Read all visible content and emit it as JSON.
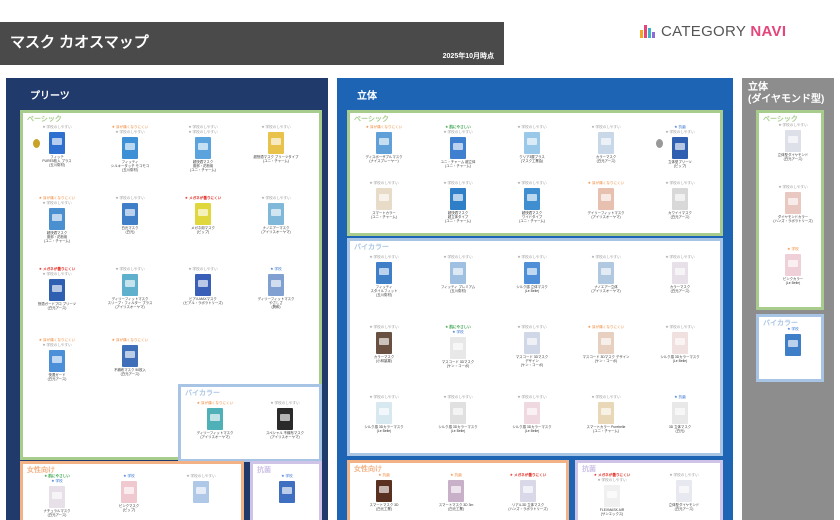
{
  "header": {
    "title": "マスク カオスマップ",
    "date": "2025年10月時点"
  },
  "logo": {
    "text_a": "CATEGORY ",
    "text_b": "NAVI",
    "bar_colors": [
      "#f6a623",
      "#e4457a",
      "#3db1c8",
      "#8c6bd6"
    ]
  },
  "columns": {
    "pleats": {
      "title": "プリーツ",
      "color": "#1f3a6b"
    },
    "rittai": {
      "title": "立体",
      "color": "#1e64b4"
    },
    "diamond": {
      "title": "立体\n(ダイヤモンド型)",
      "color": "#8d8d8d"
    }
  },
  "sections": {
    "p_basic": {
      "title": "ベーシック",
      "color": "#a8cc8c"
    },
    "p_bicolor": {
      "title": "バイカラー",
      "color": "#a8c4e4"
    },
    "p_women": {
      "title": "女性向け",
      "color": "#f2b286"
    },
    "p_fashion": {
      "title": "抗菌",
      "color": "#cfc4e8"
    },
    "r_basic": {
      "title": "ベーシック",
      "color": "#a8cc8c"
    },
    "r_bicolor": {
      "title": "バイカラー",
      "color": "#a8c4e4"
    },
    "r_women": {
      "title": "女性向け",
      "color": "#f2b286"
    },
    "r_fashion": {
      "title": "抗菌",
      "color": "#cfc4e8"
    },
    "d_basic": {
      "title": "ベーシック",
      "color": "#a8cc8c"
    },
    "d_bicolor": {
      "title": "バイカラー",
      "color": "#a8c4e4"
    }
  },
  "items": [
    {
      "t1": "★ 学校のしやすい",
      "c1": "gray",
      "t2": "",
      "c2": "blank",
      "name": "フィッテ\nPURE5枚入 プラス\n(玉川衛材)",
      "color": "#2f6fd0",
      "medal": "#c9a227"
    },
    {
      "t1": "★ 耳が痛くなりにくい",
      "c1": "orange",
      "t2": "★ 学校のしやすい",
      "c2": "gray",
      "name": "フィッティ\nシルキータッチ モコモコ\n(玉川衛材)",
      "color": "#3d8fd6",
      "medal": ""
    },
    {
      "t1": "★ 学校のしやすい",
      "c1": "gray",
      "t2": "★ 学校のしやすい",
      "c2": "gray",
      "name": "超快適マスク\n風邪・花粉用\n(ユニ・チャーム)",
      "color": "#5aa3dc",
      "medal": ""
    },
    {
      "t1": "★ 学校のしやすい",
      "c1": "gray",
      "t2": "",
      "c2": "blank",
      "name": "超快適マスク プリーツタイプ\n(ユニ・チャーム)",
      "color": "#e8c24a",
      "medal": ""
    },
    {
      "t1": "★ 耳が痛くなりにくい",
      "c1": "orange",
      "t2": "★ 学校のしやすい",
      "c2": "gray",
      "name": "超快適マスク\n風邪・花粉用\n(ユニ・チャーム)",
      "color": "#4a8fd0",
      "medal": ""
    },
    {
      "t1": "★ 学校のしやすい",
      "c1": "gray",
      "t2": "",
      "c2": "blank",
      "name": "白元マスク\n(白元)",
      "color": "#3f7fc8",
      "medal": ""
    },
    {
      "t1": "★ メガネが曇りにくい",
      "c1": "red",
      "t2": "",
      "c2": "blank",
      "name": "メガネ用マスク\n(ピップ)",
      "color": "#e0d73c",
      "medal": ""
    },
    {
      "t1": "★ 学校のしやすい",
      "c1": "gray",
      "t2": "",
      "c2": "blank",
      "name": "ナノエアーマスク\n(アイリスオーヤマ)",
      "color": "#7fb8d8",
      "medal": ""
    },
    {
      "t1": "★ メガネが曇りにくい",
      "c1": "red",
      "t2": "★ 学校のしやすい",
      "c2": "gray",
      "name": "快適ガードプロ プリーツ\n(白元アース)",
      "color": "#2f5fb0",
      "medal": ""
    },
    {
      "t1": "★ 学校のしやすい",
      "c1": "gray",
      "t2": "",
      "c2": "blank",
      "name": "ディリーフィットマスク\nスリープ・フィルター プラス\n(アイリスオーヤマ)",
      "color": "#5fb0cc",
      "medal": ""
    },
    {
      "t1": "★ 学校のしやすい",
      "c1": "gray",
      "t2": "",
      "c2": "blank",
      "name": "ビアルMAXマスク\n(ビアル・ラボラトリーズ)",
      "color": "#3a5fb8",
      "medal": ""
    },
    {
      "t1": "★ 学校",
      "c1": "blue",
      "t2": "",
      "c2": "blank",
      "name": "ディリーフィットマスク\nやさしさ\n(興和)",
      "color": "#7fa0d0",
      "medal": ""
    },
    {
      "t1": "★ 耳が痛くなりにくい",
      "c1": "orange",
      "t2": "★ 学校のしやすい",
      "c2": "gray",
      "name": "快適ガード\n(白元アース)",
      "color": "#4a8fd8",
      "medal": ""
    },
    {
      "t1": "★ 耳が痛くなりにくい",
      "c1": "orange",
      "t2": "",
      "c2": "blank",
      "name": "不織布マスク 50枚入\n(白元アース)",
      "color": "#3f6fb8",
      "medal": ""
    },
    {
      "t1": "★ 耳が痛くなりにくい",
      "c1": "orange",
      "t2": "",
      "c2": "blank",
      "name": "ディリーフィットマスク\n(アイリスオーヤマ)",
      "color": "#4fb0b8",
      "medal": ""
    },
    {
      "t1": "★ 学校のしやすい",
      "c1": "gray",
      "t2": "",
      "c2": "blank",
      "name": "スペシャル 不織布マスク\n(アイリスオーヤマ)",
      "color": "#2a2a2a",
      "medal": ""
    },
    {
      "t1": "★ 耳が痛くなりにくい",
      "c1": "orange",
      "t2": "",
      "c2": "blank",
      "name": "ディスポーザブルマスク\n(ナイスプレーヤー)",
      "color": "#5fa0d8",
      "medal": ""
    },
    {
      "t1": "★ 肌にやさしい",
      "c1": "green",
      "t2": "★ 学校のしやすい",
      "c2": "gray",
      "name": "ユニ・チャーム 超立体\n(ユニ・チャーム)",
      "color": "#3f7fd0",
      "medal": ""
    },
    {
      "t1": "★ 学校のしやすい",
      "c1": "gray",
      "t2": "",
      "c2": "blank",
      "name": "クリア3層プラス\n(マスク工業会)",
      "color": "#9ac8e8",
      "medal": ""
    },
    {
      "t1": "★ 学校のしやすい",
      "c1": "gray",
      "t2": "",
      "c2": "blank",
      "name": "カラーマスク\n(白元アース)",
      "color": "#c8d8e8",
      "medal": ""
    },
    {
      "t1": "★ 抗菌",
      "c1": "blue",
      "t2": "★ 学校のしやすい",
      "c2": "gray",
      "name": "立体型プリーツ\n(ピップ)",
      "color": "#2f5fb0",
      "medal": "#999"
    },
    {
      "t1": "★ 学校のしやすい",
      "c1": "gray",
      "t2": "",
      "c2": "blank",
      "name": "スマートカラー\n(ユニ・チャーム)",
      "color": "#e8dcc8",
      "medal": ""
    },
    {
      "t1": "★ 学校のしやすい",
      "c1": "gray",
      "t2": "",
      "c2": "blank",
      "name": "超快適マスク\n超立体タイプ\n(ユニ・チャーム)",
      "color": "#2f7fc8",
      "medal": ""
    },
    {
      "t1": "★ 学校のしやすい",
      "c1": "gray",
      "t2": "",
      "c2": "blank",
      "name": "超快適マスク\nワイドタイプ\n(ユニ・チャーム)",
      "color": "#3f8fd0",
      "medal": ""
    },
    {
      "t1": "★ 耳が痛くなりにくい",
      "c1": "orange",
      "t2": "",
      "c2": "blank",
      "name": "デイリーフィットマスク\n(アイリスオーヤマ)",
      "color": "#e8c0b0",
      "medal": ""
    },
    {
      "t1": "★ 学校のしやすい",
      "c1": "gray",
      "t2": "",
      "c2": "blank",
      "name": "カワイイマスク\n(白元アース)",
      "color": "#d8d8d8",
      "medal": ""
    },
    {
      "t1": "★ 学校のしやすい",
      "c1": "gray",
      "t2": "",
      "c2": "blank",
      "name": "フィッティ\nスタイルフィット\n(玉川衛材)",
      "color": "#3f7fc8",
      "medal": ""
    },
    {
      "t1": "★ 学校のしやすい",
      "c1": "gray",
      "t2": "",
      "c2": "blank",
      "name": "フィッティ プレミアム\n(玉川衛材)",
      "color": "#9fc0e0",
      "medal": ""
    },
    {
      "t1": "★ 学校のしやすい",
      "c1": "gray",
      "t2": "",
      "c2": "blank",
      "name": "シルク感 立体マスク\n(Le Belle)",
      "color": "#4f8fd8",
      "medal": ""
    },
    {
      "t1": "★ 学校のしやすい",
      "c1": "gray",
      "t2": "",
      "c2": "blank",
      "name": "ナノエアー立体\n(アイリスオーヤマ)",
      "color": "#b0c8e0",
      "medal": ""
    },
    {
      "t1": "★ 学校のしやすい",
      "c1": "gray",
      "t2": "",
      "c2": "blank",
      "name": "カラーマスク\n(白元アース)",
      "color": "#e8e0e8",
      "medal": ""
    },
    {
      "t1": "★ 学校のしやすい",
      "c1": "gray",
      "t2": "",
      "c2": "blank",
      "name": "カラーマスク\n(小林製薬)",
      "color": "#6a5040",
      "medal": ""
    },
    {
      "t1": "★ 肌にやさしい",
      "c1": "green",
      "t2": "★ 学校",
      "c2": "blue",
      "name": "マスコード 3Dマスク\n(ケン・コーポ)",
      "color": "#e8e8e8",
      "medal": ""
    },
    {
      "t1": "★ 学校のしやすい",
      "c1": "gray",
      "t2": "",
      "c2": "blank",
      "name": "マスコード 3Dマスク\nデザイン\n(ケン・コーポ)",
      "color": "#d0d8e8",
      "medal": ""
    },
    {
      "t1": "★ 耳が痛くなりにくい",
      "c1": "orange",
      "t2": "",
      "c2": "blank",
      "name": "マスコード 3Dマスク デザイン\n(ケン・コーポ)",
      "color": "#e8d0c0",
      "medal": ""
    },
    {
      "t1": "★ 学校のしやすい",
      "c1": "gray",
      "t2": "",
      "c2": "blank",
      "name": "シルク感 3Dカラーマスク\n(Le Belle)",
      "color": "#f0e0e0",
      "medal": ""
    },
    {
      "t1": "★ 学校のしやすい",
      "c1": "gray",
      "t2": "",
      "c2": "blank",
      "name": "シルク感 3Dカラーマスク\n(Le Belle)",
      "color": "#d8e8f0",
      "medal": ""
    },
    {
      "t1": "★ 学校のしやすい",
      "c1": "gray",
      "t2": "",
      "c2": "blank",
      "name": "シルク感 3Dカラーマスク\n(Le Belle)",
      "color": "#e0e0e0",
      "medal": ""
    },
    {
      "t1": "★ 学校のしやすい",
      "c1": "gray",
      "t2": "",
      "c2": "blank",
      "name": "シルク感 3Dカラーマスク\n(Le Belle)",
      "color": "#f0d8e0",
      "medal": ""
    },
    {
      "t1": "★ 学校のしやすい",
      "c1": "gray",
      "t2": "",
      "c2": "blank",
      "name": "スマートカラー Purebelle\n(ユニ・チャーム)",
      "color": "#e8d8b8",
      "medal": ""
    },
    {
      "t1": "★ 抗菌",
      "c1": "blue",
      "t2": "",
      "c2": "blank",
      "name": "3D 立体マスク\n(白元)",
      "color": "#e8e8e8",
      "medal": ""
    },
    {
      "t1": "★ 抗菌",
      "c1": "orange",
      "t2": "",
      "c2": "blank",
      "name": "スマートマスク 3D\n(白元工業)",
      "color": "#5a3020",
      "medal": ""
    },
    {
      "t1": "★ 抗菌",
      "c1": "orange",
      "t2": "",
      "c2": "blank",
      "name": "スマートマスク 3D 3m\n(白元工業)",
      "color": "#c8b0c8",
      "medal": ""
    },
    {
      "t1": "★ メガネが曇りにくい",
      "c1": "red",
      "t2": "",
      "c2": "blank",
      "name": "リアル3D 立体マスク\n(ハンズ・ラボラトリーズ)",
      "color": "#d8d8e8",
      "medal": ""
    },
    {
      "t1": "★ メガネが曇りにくい",
      "c1": "red",
      "t2": "★ 学校のしやすい",
      "c2": "gray",
      "name": "FLEXMASK AIR\n(サンエックス)",
      "color": "#f0f0f0",
      "medal": ""
    },
    {
      "t1": "★ 学校のしやすい",
      "c1": "gray",
      "t2": "",
      "c2": "blank",
      "name": "立体型ダイヤモンド\n(白元アース)",
      "color": "#e8e8f0",
      "medal": ""
    },
    {
      "t1": "★ 学校のしやすい",
      "c1": "gray",
      "t2": "",
      "c2": "blank",
      "name": "立体型ダイヤモンド\n(白元アース)",
      "color": "#dde0e8",
      "medal": ""
    },
    {
      "t1": "★ 学校のしやすい",
      "c1": "gray",
      "t2": "",
      "c2": "blank",
      "name": "ダイヤモンドカラー\n(ハンズ・ラボラトリーズ)",
      "color": "#e8c8c0",
      "medal": ""
    },
    {
      "t1": "★ 学校",
      "c1": "orange",
      "t2": "",
      "c2": "blank",
      "name": "ピンクカラー\n(Le Belle)",
      "color": "#f0d0d8",
      "medal": ""
    },
    {
      "t1": "★ 肌にやさしい",
      "c1": "green",
      "t2": "★ 学校",
      "c2": "blue",
      "name": "ナチュラルマスク\n(白元アース)",
      "color": "#e8e0e8",
      "medal": ""
    },
    {
      "t1": "★ 学校",
      "c1": "blue",
      "t2": "",
      "c2": "blank",
      "name": "ピンクマスク\n(ピップ)",
      "color": "#f0c8d0",
      "medal": ""
    },
    {
      "t1": "★ 学校のしやすい",
      "c1": "gray",
      "t2": "",
      "c2": "blank",
      "name": "",
      "color": "#b0c8e8",
      "medal": ""
    },
    {
      "t1": "★ 学校",
      "c1": "blue",
      "t2": "",
      "c2": "blank",
      "name": "",
      "color": "#3f6fc0",
      "medal": ""
    },
    {
      "t1": "★ 学校",
      "c1": "blue",
      "t2": "",
      "c2": "blank",
      "name": "",
      "color": "#3f7fc8",
      "medal": ""
    },
    {
      "t1": "★ 学校のしやすい",
      "c1": "gray",
      "t2": "",
      "c2": "blank",
      "name": "",
      "color": "#e8e8e8",
      "medal": ""
    },
    {
      "t1": "★ 学校のしやすい",
      "c1": "gray",
      "t2": "",
      "c2": "blank",
      "name": "",
      "color": "#e8e0d8",
      "medal": ""
    },
    {
      "t1": "★ 学校のしやすい",
      "c1": "gray",
      "t2": "",
      "c2": "blank",
      "name": "",
      "color": "#7fb0d8",
      "medal": ""
    }
  ]
}
